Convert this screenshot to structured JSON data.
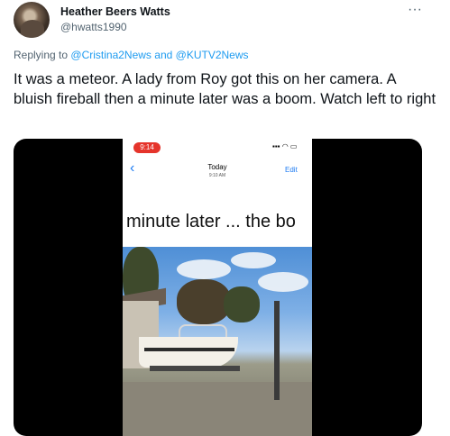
{
  "tweet": {
    "author_name": "Heather Beers Watts",
    "author_handle": "@hwatts1990",
    "more_icon": "···",
    "reply_prefix": "Replying to",
    "reply_mention_1": "@Cristina2News",
    "reply_and": "and",
    "reply_mention_2": "@KUTV2News",
    "text": "It was a meteor. A lady from Roy got this on her camera. A bluish fireball then a minute later was a boom. Watch left to right"
  },
  "video": {
    "status_time": "9:14",
    "status_icons": "▪▪▪ ◠ ▭",
    "back_icon": "‹",
    "header_title": "Today",
    "header_subtitle": "9:10 AM",
    "edit_label": "Edit",
    "caption": "minute later ... the bo"
  }
}
